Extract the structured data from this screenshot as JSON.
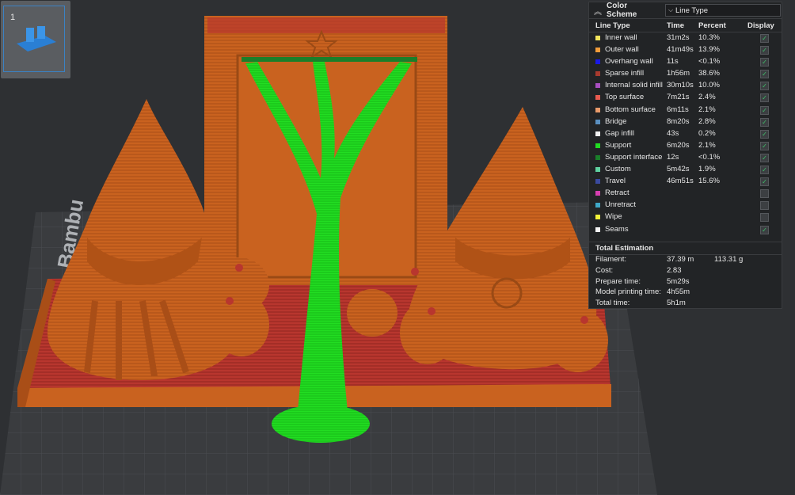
{
  "thumbnail": {
    "plate_number": "1"
  },
  "legend": {
    "title": "Color Scheme",
    "scheme_value": "Line Type",
    "columns": {
      "type": "Line Type",
      "time": "Time",
      "percent": "Percent",
      "display": "Display"
    },
    "rows": [
      {
        "name": "Inner wall",
        "time": "31m2s",
        "percent": "10.3%",
        "color": "#f2e45c",
        "display": true
      },
      {
        "name": "Outer wall",
        "time": "41m49s",
        "percent": "13.9%",
        "color": "#f29c3a",
        "display": true
      },
      {
        "name": "Overhang wall",
        "time": "11s",
        "percent": "<0.1%",
        "color": "#1a1ae6",
        "display": true
      },
      {
        "name": "Sparse infill",
        "time": "1h56m",
        "percent": "38.6%",
        "color": "#a83a2e",
        "display": true
      },
      {
        "name": "Internal solid infill",
        "time": "30m10s",
        "percent": "10.0%",
        "color": "#a84ec0",
        "display": true
      },
      {
        "name": "Top surface",
        "time": "7m21s",
        "percent": "2.4%",
        "color": "#e85a4f",
        "display": true
      },
      {
        "name": "Bottom surface",
        "time": "6m11s",
        "percent": "2.1%",
        "color": "#e89a6a",
        "display": true
      },
      {
        "name": "Bridge",
        "time": "8m20s",
        "percent": "2.8%",
        "color": "#5a8fc0",
        "display": true
      },
      {
        "name": "Gap infill",
        "time": "43s",
        "percent": "0.2%",
        "color": "#f0f0f0",
        "display": true
      },
      {
        "name": "Support",
        "time": "6m20s",
        "percent": "2.1%",
        "color": "#22dd22",
        "display": true
      },
      {
        "name": "Support interface",
        "time": "12s",
        "percent": "<0.1%",
        "color": "#1a7f2a",
        "display": true
      },
      {
        "name": "Custom",
        "time": "5m42s",
        "percent": "1.9%",
        "color": "#5fd1a0",
        "display": true
      },
      {
        "name": "Travel",
        "time": "46m51s",
        "percent": "15.6%",
        "color": "#3a4aa0",
        "display": true
      },
      {
        "name": "Retract",
        "time": "",
        "percent": "",
        "color": "#d63fb0",
        "display": false
      },
      {
        "name": "Unretract",
        "time": "",
        "percent": "",
        "color": "#3fa8c8",
        "display": false
      },
      {
        "name": "Wipe",
        "time": "",
        "percent": "",
        "color": "#f2f23a",
        "display": false
      },
      {
        "name": "Seams",
        "time": "",
        "percent": "",
        "color": "#f4f4f4",
        "display": true
      }
    ]
  },
  "estimation": {
    "title": "Total Estimation",
    "filament_label": "Filament:",
    "filament_length": "37.39 m",
    "filament_weight": "113.31 g",
    "cost_label": "Cost:",
    "cost": "2.83",
    "prepare_label": "Prepare time:",
    "prepare": "5m29s",
    "model_label": "Model printing time:",
    "model": "4h55m",
    "total_label": "Total time:",
    "total": "5h1m"
  },
  "colors": {
    "background": "#2e3033",
    "plate": "#3a3c3f",
    "model": "#c9621f",
    "support": "#22dd22",
    "base_red": "#b83a30"
  }
}
